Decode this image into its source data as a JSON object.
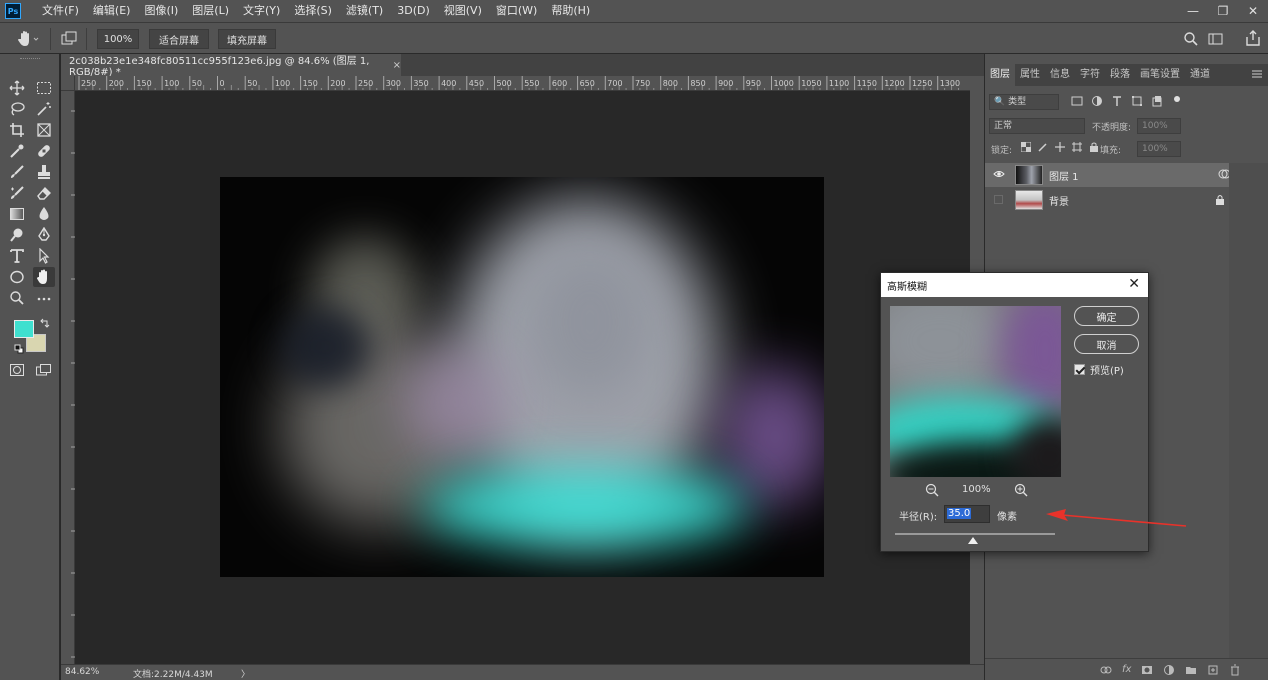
{
  "app": {
    "logo": "Ps"
  },
  "menu": [
    "文件(F)",
    "编辑(E)",
    "图像(I)",
    "图层(L)",
    "文字(Y)",
    "选择(S)",
    "滤镜(T)",
    "3D(D)",
    "视图(V)",
    "窗口(W)",
    "帮助(H)"
  ],
  "window_controls": {
    "minimize": "—",
    "restore": "❐",
    "close": "✕"
  },
  "options_bar": {
    "zoom_value": "100%",
    "fit_screen": "适合屏幕",
    "fill_screen": "填充屏幕"
  },
  "document": {
    "tab_title": "2c038b23e1e348fc80511cc955f123e6.jpg  @  84.6%  (图层 1, RGB/8#) *",
    "close": "×"
  },
  "ruler": {
    "h_labels": [
      "250",
      "200",
      "150",
      "100",
      "50",
      "0",
      "50",
      "100",
      "150",
      "200",
      "250",
      "300",
      "350",
      "400",
      "450",
      "500",
      "550",
      "600",
      "650",
      "700",
      "750",
      "800",
      "850",
      "900",
      "950",
      "1000",
      "1050",
      "1100",
      "1150",
      "1200",
      "1250",
      "1300"
    ]
  },
  "status": {
    "zoom": "84.62%",
    "doc_size": "文档:2.22M/4.43M",
    "arrow": "〉"
  },
  "panel": {
    "tabs": [
      "图层",
      "属性",
      "信息",
      "字符",
      "段落",
      "画笔设置",
      "通道"
    ],
    "active_tab": "图层",
    "filter_kind": "类型",
    "blend_mode": "正常",
    "opacity_label": "不透明度:",
    "opacity_value": "100%",
    "lock_label": "锁定:",
    "fill_label": "填充:",
    "fill_value": "100%",
    "layers": [
      {
        "name": "图层 1",
        "visible": true,
        "selected": true
      },
      {
        "name": "背景",
        "visible": false,
        "selected": false,
        "locked": true
      }
    ]
  },
  "colors": {
    "foreground": "#3fe0cf",
    "background": "#d9d6b0",
    "arrow": "#e8322a"
  },
  "dialog": {
    "title": "高斯模糊",
    "ok": "确定",
    "cancel": "取消",
    "preview_label": "预览(P)",
    "preview_checked": true,
    "zoom": "100%",
    "zoom_out_icon": "zoom-out-icon",
    "zoom_in_icon": "zoom-in-icon",
    "radius_label": "半径(R):",
    "radius_value": "35.0",
    "radius_unit": "像素",
    "slider_fraction": 0.49
  }
}
